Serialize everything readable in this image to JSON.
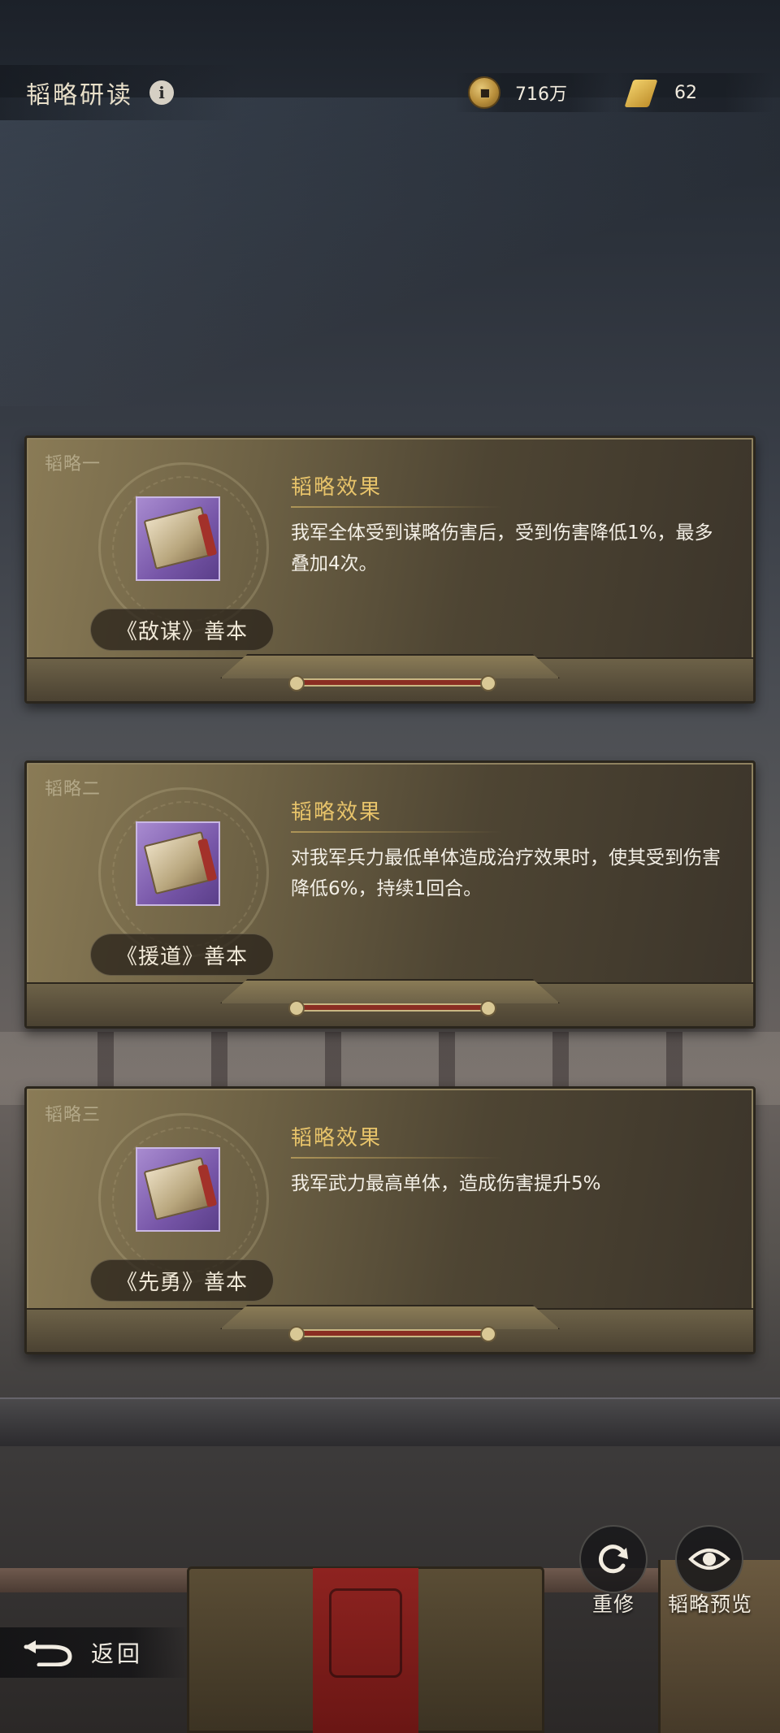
{
  "header": {
    "title": "韬略研读",
    "coins": "716万",
    "scrolls": "62"
  },
  "cards": [
    {
      "tag": "韬略一",
      "book_name": "《敌谋》善本",
      "effect_title": "韬略效果",
      "effect_text": "我军全体受到谋略伤害后，受到伤害降低1%，最多叠加4次。"
    },
    {
      "tag": "韬略二",
      "book_name": "《援道》善本",
      "effect_title": "韬略效果",
      "effect_text": "对我军兵力最低单体造成治疗效果时，使其受到伤害降低6%，持续1回合。"
    },
    {
      "tag": "韬略三",
      "book_name": "《先勇》善本",
      "effect_title": "韬略效果",
      "effect_text": "我军武力最高单体，造成伤害提升5%"
    }
  ],
  "actions": {
    "reforge_label": "重修",
    "preview_label": "韬略预览",
    "back_label": "返回"
  },
  "colors": {
    "accent_gold": "#e7c36a",
    "slot_purple": "#7756a8"
  }
}
